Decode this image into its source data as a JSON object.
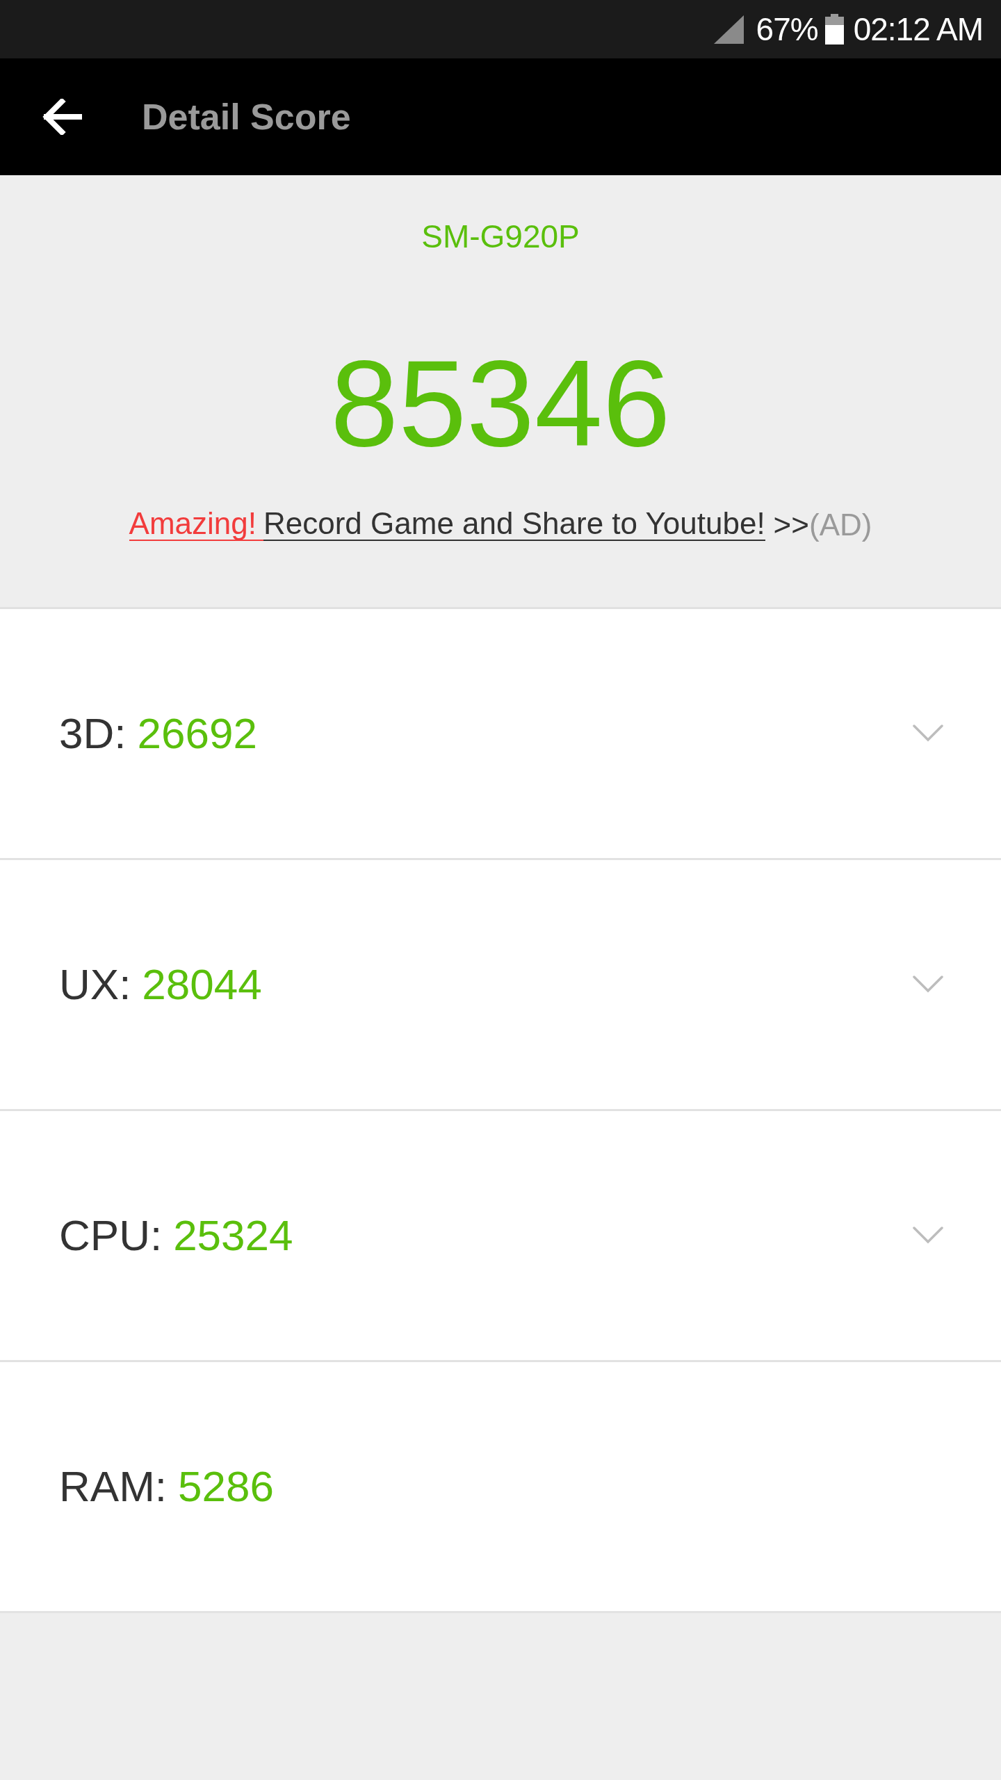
{
  "status_bar": {
    "battery": "67%",
    "time": "02:12 AM"
  },
  "app_bar": {
    "title": "Detail Score"
  },
  "summary": {
    "device": "SM-G920P",
    "total_score": "85346",
    "promo": {
      "highlight": "Amazing!",
      "link": "Record Game and Share to Youtube!",
      "arrows": ">>",
      "tag": "(AD)"
    }
  },
  "scores": [
    {
      "label": "3D:",
      "value": "26692",
      "expandable": true
    },
    {
      "label": "UX:",
      "value": "28044",
      "expandable": true
    },
    {
      "label": "CPU:",
      "value": "25324",
      "expandable": true
    },
    {
      "label": "RAM:",
      "value": "5286",
      "expandable": false
    }
  ]
}
